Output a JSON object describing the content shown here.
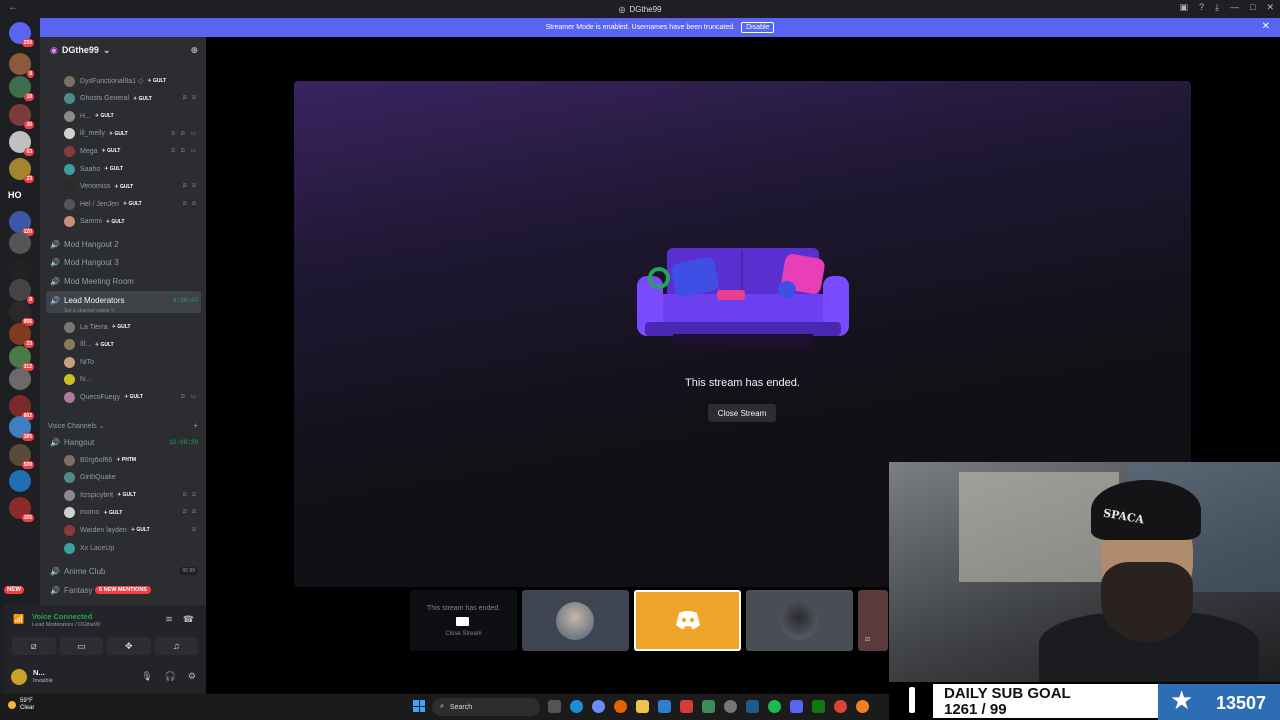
{
  "window": {
    "title": "DGthe99"
  },
  "banner": {
    "message": "Streamer Mode is enabled. Usernames have been truncated.",
    "button": "Disable"
  },
  "guilds": [
    {
      "badge": "250"
    },
    {
      "badge": "8"
    },
    {
      "badge": "18"
    },
    {
      "badge": "30"
    },
    {
      "badge": "63"
    },
    {
      "badge": "23"
    },
    {
      "text": "HO"
    },
    {
      "badge": "120"
    },
    {
      "badge": ""
    },
    {
      "badge": ""
    },
    {
      "badge": "8"
    },
    {
      "badge": "956"
    },
    {
      "badge": "23"
    },
    {
      "badge": "312"
    },
    {
      "badge": ""
    },
    {
      "badge": "802"
    },
    {
      "badge": "385"
    },
    {
      "badge": "500"
    },
    {
      "badge": ""
    },
    {
      "badge": "355"
    }
  ],
  "guild_new": "NEW",
  "server": {
    "name": "DGthe99"
  },
  "users_top": [
    {
      "name": "DysFunctional8a1 ◇",
      "tag": "GULT",
      "icons": ""
    },
    {
      "name": "Ghosts General",
      "tag": "GULT",
      "icons": "⧄ ⧄"
    },
    {
      "name": "H...",
      "tag": "GULT",
      "icons": ""
    },
    {
      "name": "lil_melly",
      "tag": "GULT",
      "icons": "⧄ ⧄ ▭"
    },
    {
      "name": "Mega",
      "tag": "GULT",
      "icons": "⧄ ⧄ ▭"
    },
    {
      "name": "Saaho",
      "tag": "GULT",
      "icons": ""
    },
    {
      "name": "Venomiss",
      "tag": "GULT",
      "icons": "⧄ ⧄"
    },
    {
      "name": "Hel / JenJen",
      "tag": "GULT",
      "icons": "⧄ ⧄"
    },
    {
      "name": "Sammi",
      "tag": "GULT",
      "icons": ""
    }
  ],
  "channels_mid": [
    "Mod Hangout 2",
    "Mod Hangout 3",
    "Mod Meeting Room"
  ],
  "lead_mods": {
    "name": "Lead Moderators",
    "time": "4:30:47",
    "status": "Set a channel status"
  },
  "users_lead": [
    {
      "name": "La Tierra",
      "tag": "GULT",
      "icons": ""
    },
    {
      "name": "Ill...",
      "tag": "GULT",
      "icons": ""
    },
    {
      "name": "NiTo",
      "tag": "",
      "icons": ""
    },
    {
      "name": "N...",
      "tag": "",
      "icons": ""
    },
    {
      "name": "QuecoFuegy",
      "tag": "GULT",
      "icons": "⧄ ▭"
    }
  ],
  "category_voice": "Voice Channels",
  "hangout": {
    "name": "Hangout",
    "time": "12:08:39"
  },
  "users_hangout": [
    {
      "name": "B0rg6of66",
      "tag": "PHTM",
      "icons": ""
    },
    {
      "name": "GirthQuake",
      "tag": "",
      "icons": ""
    },
    {
      "name": "Itzspicybrit",
      "tag": "GULT",
      "icons": "⧄ ⧄"
    },
    {
      "name": "momo",
      "tag": "GULT",
      "icons": "⧄ ⧄"
    },
    {
      "name": "Warden layden",
      "tag": "GULT",
      "icons": "⧄"
    },
    {
      "name": "Xx LaceUp",
      "tag": "",
      "icons": ""
    }
  ],
  "anime_club": {
    "name": "Anime Club",
    "count_a": "00",
    "count_b": "99"
  },
  "fantasy": {
    "name": "Fantasy",
    "mentions": "6 NEW MENTIONS"
  },
  "voice": {
    "status": "Voice Connected",
    "channel": "Lead Moderators / DGthe99"
  },
  "user": {
    "name": "N...",
    "status": "Invisible"
  },
  "stream": {
    "ended": "This stream has ended.",
    "close": "Close Stream"
  },
  "tile_ended": {
    "text": "This stream has ended.",
    "close": "Close Stream"
  },
  "webcam": {
    "beanie": "SPACA"
  },
  "subgoal": {
    "label": "DAILY SUB GOAL",
    "progress": "1261 / 99",
    "total": "13507"
  },
  "taskbar": {
    "weather_temp": "59°F",
    "weather_desc": "Clear",
    "search": "Search"
  }
}
